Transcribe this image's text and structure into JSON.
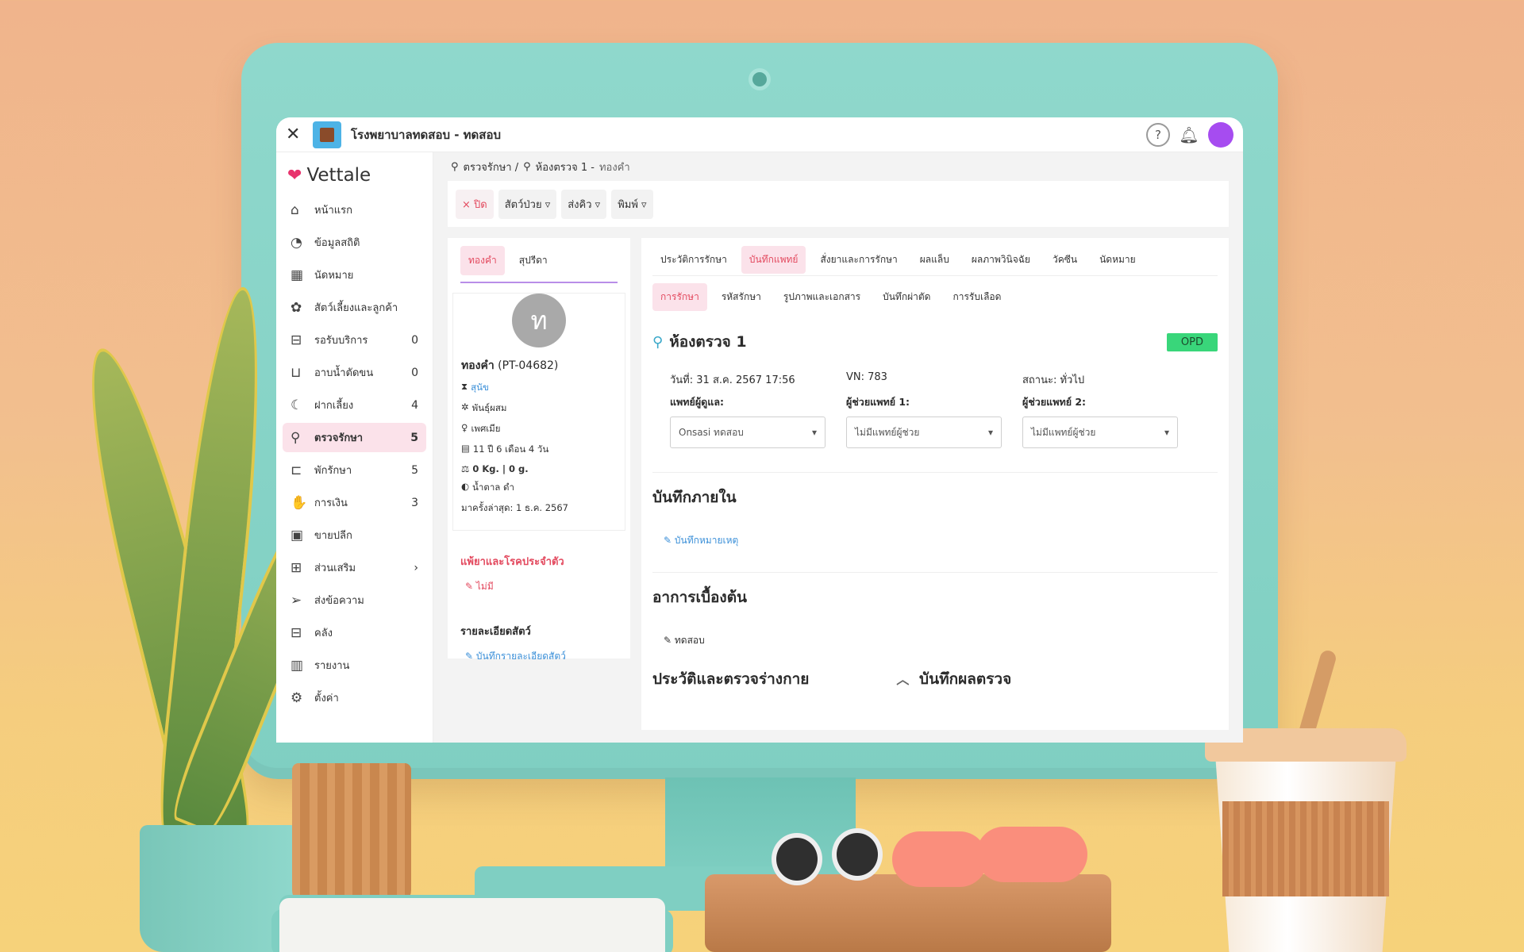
{
  "window": {
    "title": "โรงพยาบาลทดสอบ - ทดสอบ",
    "close_icon": "close-icon",
    "help_icon": "help-icon",
    "bell_icon": "bell-icon"
  },
  "brand": {
    "name": "Vettale",
    "color": "#e8336d"
  },
  "sidebar": {
    "items": [
      {
        "label": "หน้าแรก",
        "icon": "home-icon",
        "count": ""
      },
      {
        "label": "ข้อมูลสถิติ",
        "icon": "dashboard-icon",
        "count": ""
      },
      {
        "label": "นัดหมาย",
        "icon": "calendar-icon",
        "count": ""
      },
      {
        "label": "สัตว์เลี้ยงและลูกค้า",
        "icon": "paw-icon",
        "count": ""
      },
      {
        "label": "รอรับบริการ",
        "icon": "sofa-icon",
        "count": "0"
      },
      {
        "label": "อาบน้ำตัดขน",
        "icon": "bath-icon",
        "count": "0"
      },
      {
        "label": "ฝากเลี้ยง",
        "icon": "moon-icon",
        "count": "4"
      },
      {
        "label": "ตรวจรักษา",
        "icon": "stethoscope-icon",
        "count": "5"
      },
      {
        "label": "พักรักษา",
        "icon": "bed-icon",
        "count": "5"
      },
      {
        "label": "การเงิน",
        "icon": "money-icon",
        "count": "3"
      },
      {
        "label": "ขายปลีก",
        "icon": "shop-icon",
        "count": ""
      },
      {
        "label": "ส่วนเสริม",
        "icon": "plus-square-icon",
        "count": "›"
      },
      {
        "label": "ส่งข้อความ",
        "icon": "send-icon",
        "count": ""
      },
      {
        "label": "คลัง",
        "icon": "archive-icon",
        "count": ""
      },
      {
        "label": "รายงาน",
        "icon": "report-icon",
        "count": ""
      },
      {
        "label": "ตั้งค่า",
        "icon": "settings-icon",
        "count": ""
      }
    ]
  },
  "breadcrumb": {
    "part1": "ตรวจรักษา /",
    "part2": "ห้องตรวจ 1 -",
    "part3": "ทองคำ"
  },
  "toolbar": {
    "close": "× ปิด",
    "animal": "สัตว์ป่วย ▿",
    "queue": "ส่งคิว ▿",
    "print": "พิมพ์ ▿"
  },
  "pet": {
    "tabs": [
      "ทองคำ",
      "สุปรีดา"
    ],
    "initial": "ท",
    "name": "ทองคำ",
    "code": "(PT-04682)",
    "species": "สุนัข",
    "breed": "พันธุ์ผสม",
    "sex": "เพศเมีย",
    "age": "11 ปี 6 เดือน 4 วัน",
    "weight": "0 Kg. | 0 g.",
    "color": "น้ำตาล ดำ",
    "last_visit": "มาครั้งล่าสุด: 1 ธ.ค. 2567",
    "allergy_title": "แพ้ยาและโรคประจำตัว",
    "allergy_value": "ไม่มี",
    "detail_title": "รายละเอียดสัตว์",
    "detail_link": "บันทึกรายละเอียดสัตว์"
  },
  "record": {
    "tabs": [
      "ประวัติการรักษา",
      "บันทึกแพทย์",
      "สั่งยาและการรักษา",
      "ผลแล็บ",
      "ผลภาพวินิจฉัย",
      "วัคซีน",
      "นัดหมาย"
    ],
    "sub_tabs": [
      "การรักษา",
      "รหัสรักษา",
      "รูปภาพและเอกสาร",
      "บันทึกผ่าตัด",
      "การรับเลือด"
    ],
    "room_title": "ห้องตรวจ 1",
    "badge": "OPD",
    "date": "วันที่: 31 ส.ค. 2567 17:56",
    "vn": "VN: 783",
    "status": "สถานะ: ทั่วไป",
    "doctor_label": "แพทย์ผู้ดูแล:",
    "doctor_value": "Onsasi ทดสอบ",
    "assistant1_label": "ผู้ช่วยแพทย์ 1:",
    "assistant1_value": "ไม่มีแพทย์ผู้ช่วย",
    "assistant2_label": "ผู้ช่วยแพทย์ 2:",
    "assistant2_value": "ไม่มีแพทย์ผู้ช่วย",
    "internal_title": "บันทึกภายใน",
    "internal_link": "บันทึกหมายเหตุ",
    "symptom_title": "อาการเบื้องต้น",
    "symptom_value": "ทดสอบ",
    "history_title": "ประวัติและตรวจร่างกาย",
    "result_title": "บันทึกผลตรวจ"
  },
  "colors": {
    "accent": "#e34a5f",
    "active_bg": "#fbe2ea",
    "opd": "#39d67a",
    "link": "#3a8fd8",
    "monitor": "#7fcfc2"
  }
}
